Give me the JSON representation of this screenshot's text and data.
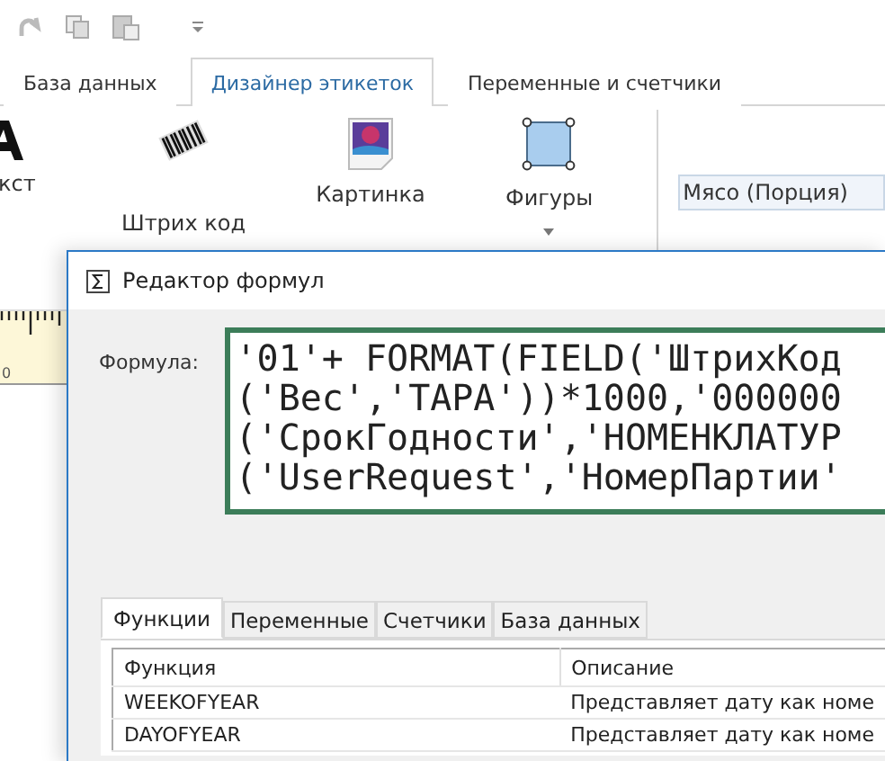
{
  "ribbon": {
    "tabs": [
      {
        "label": "База данных",
        "selected": false
      },
      {
        "label": "Дизайнер этикеток",
        "selected": true
      },
      {
        "label": "Переменные и счетчики",
        "selected": false
      }
    ],
    "tools": [
      {
        "label": "кст",
        "kind": "text"
      },
      {
        "label": "Штрих код",
        "kind": "barcode"
      },
      {
        "label": "Картинка",
        "kind": "picture"
      },
      {
        "label": "Фигуры",
        "kind": "shapes"
      }
    ],
    "combo": {
      "value": "Мясо (Порция)"
    }
  },
  "ruler": {
    "label": "0"
  },
  "dialog": {
    "title": "Редактор формул",
    "formula_label": "Формула:",
    "formula_lines": [
      "'01'+ FORMAT(FIELD('ШтрихКод",
      "('Вес','ТАРА'))*1000,'000000",
      "('СрокГодности','НОМЕНКЛАТУР",
      "('UserRequest','НомерПартии'"
    ],
    "tabs": [
      {
        "label": "Функции",
        "selected": true
      },
      {
        "label": "Переменные",
        "selected": false
      },
      {
        "label": "Счетчики",
        "selected": false
      },
      {
        "label": "База данных",
        "selected": false
      }
    ],
    "table": {
      "columns": [
        "Функция",
        "Описание"
      ],
      "rows": [
        [
          "WEEKOFYEAR",
          "Представляет дату как номе"
        ],
        [
          "DAYOFYEAR",
          "Представляет дату как номе"
        ]
      ]
    }
  }
}
